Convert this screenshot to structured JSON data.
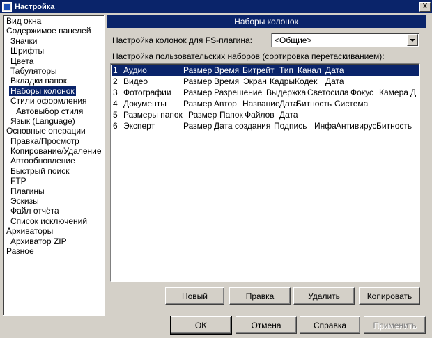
{
  "window": {
    "title": "Настройка",
    "close_glyph": "X"
  },
  "tree": {
    "items": [
      {
        "label": "Вид окна",
        "level": 0,
        "selected": false
      },
      {
        "label": "Содержимое панелей",
        "level": 0,
        "selected": false
      },
      {
        "label": "Значки",
        "level": 1,
        "selected": false
      },
      {
        "label": "Шрифты",
        "level": 1,
        "selected": false
      },
      {
        "label": "Цвета",
        "level": 1,
        "selected": false
      },
      {
        "label": "Табуляторы",
        "level": 1,
        "selected": false
      },
      {
        "label": "Вкладки папок",
        "level": 1,
        "selected": false
      },
      {
        "label": "Наборы колонок",
        "level": 1,
        "selected": true
      },
      {
        "label": "Стили оформления",
        "level": 1,
        "selected": false
      },
      {
        "label": "Автовыбор стиля",
        "level": 2,
        "selected": false
      },
      {
        "label": "Язык (Language)",
        "level": 1,
        "selected": false
      },
      {
        "label": "Основные операции",
        "level": 0,
        "selected": false
      },
      {
        "label": "Правка/Просмотр",
        "level": 1,
        "selected": false
      },
      {
        "label": "Копирование/Удаление",
        "level": 1,
        "selected": false
      },
      {
        "label": "Автообновление",
        "level": 1,
        "selected": false
      },
      {
        "label": "Быстрый поиск",
        "level": 1,
        "selected": false
      },
      {
        "label": "FTP",
        "level": 1,
        "selected": false
      },
      {
        "label": "Плагины",
        "level": 1,
        "selected": false
      },
      {
        "label": "Эскизы",
        "level": 1,
        "selected": false
      },
      {
        "label": "Файл отчёта",
        "level": 1,
        "selected": false
      },
      {
        "label": "Список исключений",
        "level": 1,
        "selected": false
      },
      {
        "label": "Архиваторы",
        "level": 0,
        "selected": false
      },
      {
        "label": "Архиватор ZIP",
        "level": 1,
        "selected": false
      },
      {
        "label": "Разное",
        "level": 0,
        "selected": false
      }
    ]
  },
  "panel": {
    "header": "Наборы колонок",
    "fs_label": "Настройка колонок для FS-плагина:",
    "fs_value": "<Общие>",
    "sets_label": "Настройка пользовательских наборов (сортировка перетаскиванием):",
    "sets": [
      {
        "num": "1",
        "name": "Аудио",
        "columns": [
          "Размер",
          "Время",
          "Битрейт",
          "Тип",
          "Канал",
          "Дата"
        ],
        "selected": true
      },
      {
        "num": "2",
        "name": "Видео",
        "columns": [
          "Размер",
          "Время",
          "Экран",
          "Кадры",
          "Кодек",
          "Дата"
        ],
        "selected": false
      },
      {
        "num": "3",
        "name": "Фотографии",
        "columns": [
          "Размер",
          "Разрешение",
          "Выдержка",
          "Светосила",
          "Фокус",
          "Камера",
          "Д"
        ],
        "selected": false
      },
      {
        "num": "4",
        "name": "Документы",
        "columns": [
          "Размер",
          "Автор",
          "Название",
          "Дата",
          "Битность",
          "Система"
        ],
        "selected": false
      },
      {
        "num": "5",
        "name": "Размеры папок",
        "columns": [
          "Размер",
          "Папок",
          "Файлов",
          "Дата"
        ],
        "selected": false
      },
      {
        "num": "6",
        "name": "Эксперт",
        "columns": [
          "Размер",
          "Дата создания",
          "Подпись",
          "Инфа",
          "Антивирус",
          "Битность"
        ],
        "selected": false
      }
    ],
    "buttons": {
      "new": "Новый",
      "edit": "Правка",
      "delete": "Удалить",
      "copy": "Копировать"
    }
  },
  "footer": {
    "ok": "OK",
    "cancel": "Отмена",
    "help": "Справка",
    "apply": "Применить"
  }
}
